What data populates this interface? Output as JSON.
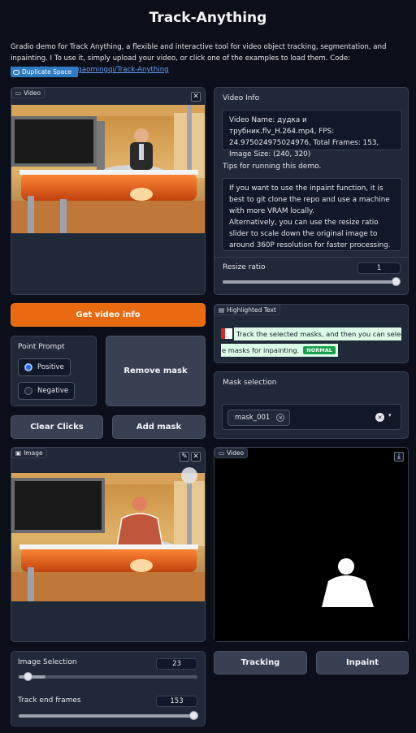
{
  "header": {
    "title": "Track-Anything",
    "description": "Gradio demo for Track Anything, a flexible and interactive tool for video object tracking, segmentation, and inpainting. I To use it, simply upload your video, or click one of the examples to load them. Code: ",
    "code_link": "https://github.com/gaomingqi/Track-Anything",
    "duplicate_label": "Duplicate Space"
  },
  "video_input": {
    "label": "Video"
  },
  "video_info": {
    "heading": "Video Info",
    "text": "Video Name: дудка и трубник.flv_H.264.mp4, FPS: 24.975024975024976, Total Frames: 153, Image Size: (240, 320)",
    "tips_heading": "Tips for running this demo.",
    "tips_text": "If you want to use the inpaint function, it is best to git clone the repo and use a machine with more VRAM locally.                          Alternatively, you can use the resize ratio slider to scale down the original image to around 360P resolution for faster processing."
  },
  "resize_ratio": {
    "label": "Resize ratio",
    "value": "1",
    "fraction": 1.0
  },
  "get_video_info_button": "Get video info",
  "point_prompt": {
    "label": "Point Prompt",
    "options": [
      "Positive",
      "Negative"
    ],
    "selected": "Positive"
  },
  "remove_mask_button": "Remove mask",
  "clear_clicks_button": "Clear Clicks",
  "add_mask_button": "Add mask",
  "highlighted_text": {
    "label": "Highlighted Text",
    "line1": "Track the selected masks, and then you can select th",
    "line2": "e masks for inpainting.",
    "badge": "NORMAL"
  },
  "mask_selection": {
    "label": "Mask selection",
    "chip": "mask_001"
  },
  "image_panel": {
    "label": "Image"
  },
  "video_output": {
    "label": "Video"
  },
  "tracking_button": "Tracking",
  "inpaint_button": "Inpaint",
  "image_selection": {
    "label": "Image Selection",
    "value": "23",
    "fraction": 0.15
  },
  "track_end_frames": {
    "label": "Track end frames",
    "value": "153",
    "fraction": 1.0
  },
  "colors": {
    "accent": "#ea6a12",
    "background": "#0b0f19",
    "panel": "#1f2937",
    "link": "#60a5fa",
    "badge": "#16a34a"
  }
}
